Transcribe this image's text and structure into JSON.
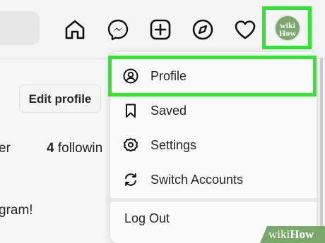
{
  "header": {
    "avatar_text_line1": "wiki",
    "avatar_text_line2": "How"
  },
  "nav_icons": [
    "home-icon",
    "messenger-icon",
    "new-post-icon",
    "explore-icon",
    "activity-heart-icon",
    "avatar"
  ],
  "profile": {
    "edit_button_label": "Edit profile",
    "followers_fragment": "er",
    "following_count": "4",
    "following_label": "followin",
    "bio_fragment": "gram!"
  },
  "menu": {
    "items": [
      {
        "label": "Profile",
        "icon": "profile-icon"
      },
      {
        "label": "Saved",
        "icon": "bookmark-icon"
      },
      {
        "label": "Settings",
        "icon": "settings-icon"
      },
      {
        "label": "Switch Accounts",
        "icon": "switch-accounts-icon"
      }
    ],
    "logout_label": "Log Out"
  },
  "highlight_color": "#2ee82e",
  "watermark": {
    "part1": "wiki",
    "part2": "How"
  }
}
